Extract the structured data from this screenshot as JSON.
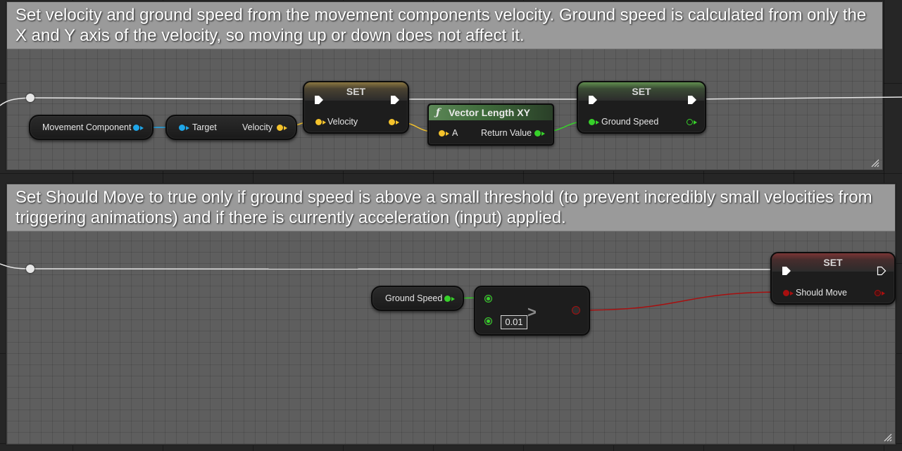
{
  "comments": {
    "top": {
      "text": "Set velocity and ground speed from the movement components velocity. Ground speed is calculated from only the X and Y axis of the velocity, so moving up or down does not affect it."
    },
    "bottom": {
      "text": "Set Should Move to true only if ground speed is above a small threshold (to prevent incredibly small velocities from triggering animations) and if there is currently acceleration (input) applied."
    }
  },
  "nodes": {
    "movement_component": {
      "label": "Movement Component"
    },
    "get_velocity": {
      "target_label": "Target",
      "output_label": "Velocity"
    },
    "set_velocity": {
      "title": "SET",
      "input_label": "Velocity"
    },
    "vector_length_xy": {
      "icon": "ƒ",
      "title": "Vector Length XY",
      "input_label": "A",
      "output_label": "Return Value"
    },
    "set_ground_speed": {
      "title": "SET",
      "input_label": "Ground Speed"
    },
    "ground_speed_getter": {
      "label": "Ground Speed"
    },
    "greater_than": {
      "operator": ">",
      "threshold": "0.01"
    },
    "set_should_move": {
      "title": "SET",
      "input_label": "Should Move"
    }
  },
  "colors": {
    "object_pin": "#1fa6e8",
    "vector_pin": "#f5c32c",
    "float_pin": "#37d12a",
    "bool_pin": "#a80f0f",
    "exec_wire": "#e6e6e6"
  }
}
